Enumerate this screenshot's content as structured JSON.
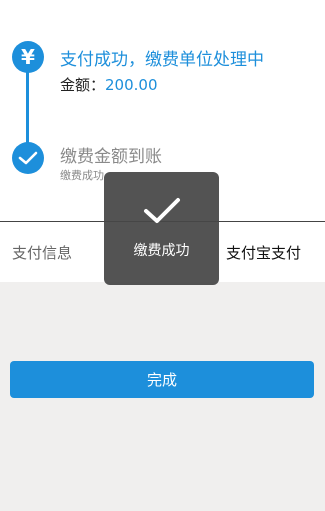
{
  "steps": [
    {
      "icon": "yen-icon",
      "icon_glyph": "¥",
      "title": "支付成功，缴费单位处理中",
      "amount_label": "金额：",
      "amount_value": "200.00"
    },
    {
      "icon": "checkmark-icon",
      "title": "缴费金额到账",
      "subtitle": "缴费成功"
    }
  ],
  "payment_info": {
    "label": "支付信息",
    "value": "支付宝支付"
  },
  "done_button": {
    "label": "完成"
  },
  "toast": {
    "icon": "checkmark-icon",
    "message": "缴费成功"
  },
  "colors": {
    "accent": "#1d8fdb",
    "background": "#f0efee",
    "card": "#ffffff",
    "toast_bg": "#464646"
  }
}
